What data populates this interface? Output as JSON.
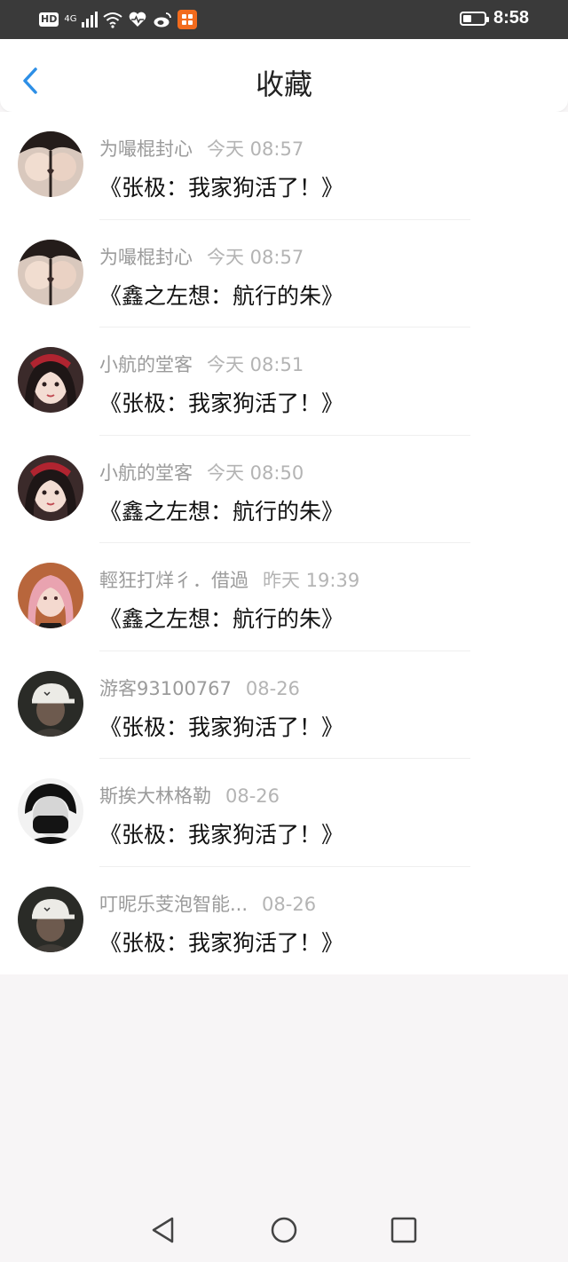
{
  "status_bar": {
    "hd": "HD",
    "network": "4G",
    "time": "8:58",
    "battery_level": 0.4,
    "icons": [
      "hd-icon",
      "signal-icon",
      "wifi-icon",
      "health-icon",
      "weibo-icon",
      "app-icon",
      "battery-icon"
    ]
  },
  "header": {
    "title": "收藏",
    "back_icon": "chevron-left-icon",
    "accent_color": "#2d8fe6"
  },
  "items": [
    {
      "name": "为嘬棍封心",
      "time": "今天 08:57",
      "message": "《张极：我家狗活了！》",
      "avatar": "avatar-couple"
    },
    {
      "name": "为嘬棍封心",
      "time": "今天 08:57",
      "message": "《鑫之左想：航行的朱》",
      "avatar": "avatar-couple"
    },
    {
      "name": "小航的堂客",
      "time": "今天 08:51",
      "message": "《张极：我家狗活了！》",
      "avatar": "avatar-girl-red"
    },
    {
      "name": "小航的堂客",
      "time": "今天 08:50",
      "message": "《鑫之左想：航行的朱》",
      "avatar": "avatar-girl-red"
    },
    {
      "name": "輕狂打烊彳．借過",
      "time": "昨天 19:39",
      "message": "《鑫之左想：航行的朱》",
      "avatar": "avatar-pink-hair"
    },
    {
      "name": "游客93100767",
      "time": "08-26",
      "message": "《张极：我家狗活了！》",
      "avatar": "avatar-cap-boy"
    },
    {
      "name": "斯挨大林格勒",
      "time": "08-26",
      "message": "《张极：我家狗活了！》",
      "avatar": "avatar-bw-mask"
    },
    {
      "name": "叮昵乐芰泡智能...",
      "time": "08-26",
      "message": "《张极：我家狗活了！》",
      "avatar": "avatar-cap-boy"
    }
  ],
  "nav_bar": {
    "icons": [
      "back-triangle-icon",
      "home-circle-icon",
      "recents-square-icon"
    ]
  }
}
